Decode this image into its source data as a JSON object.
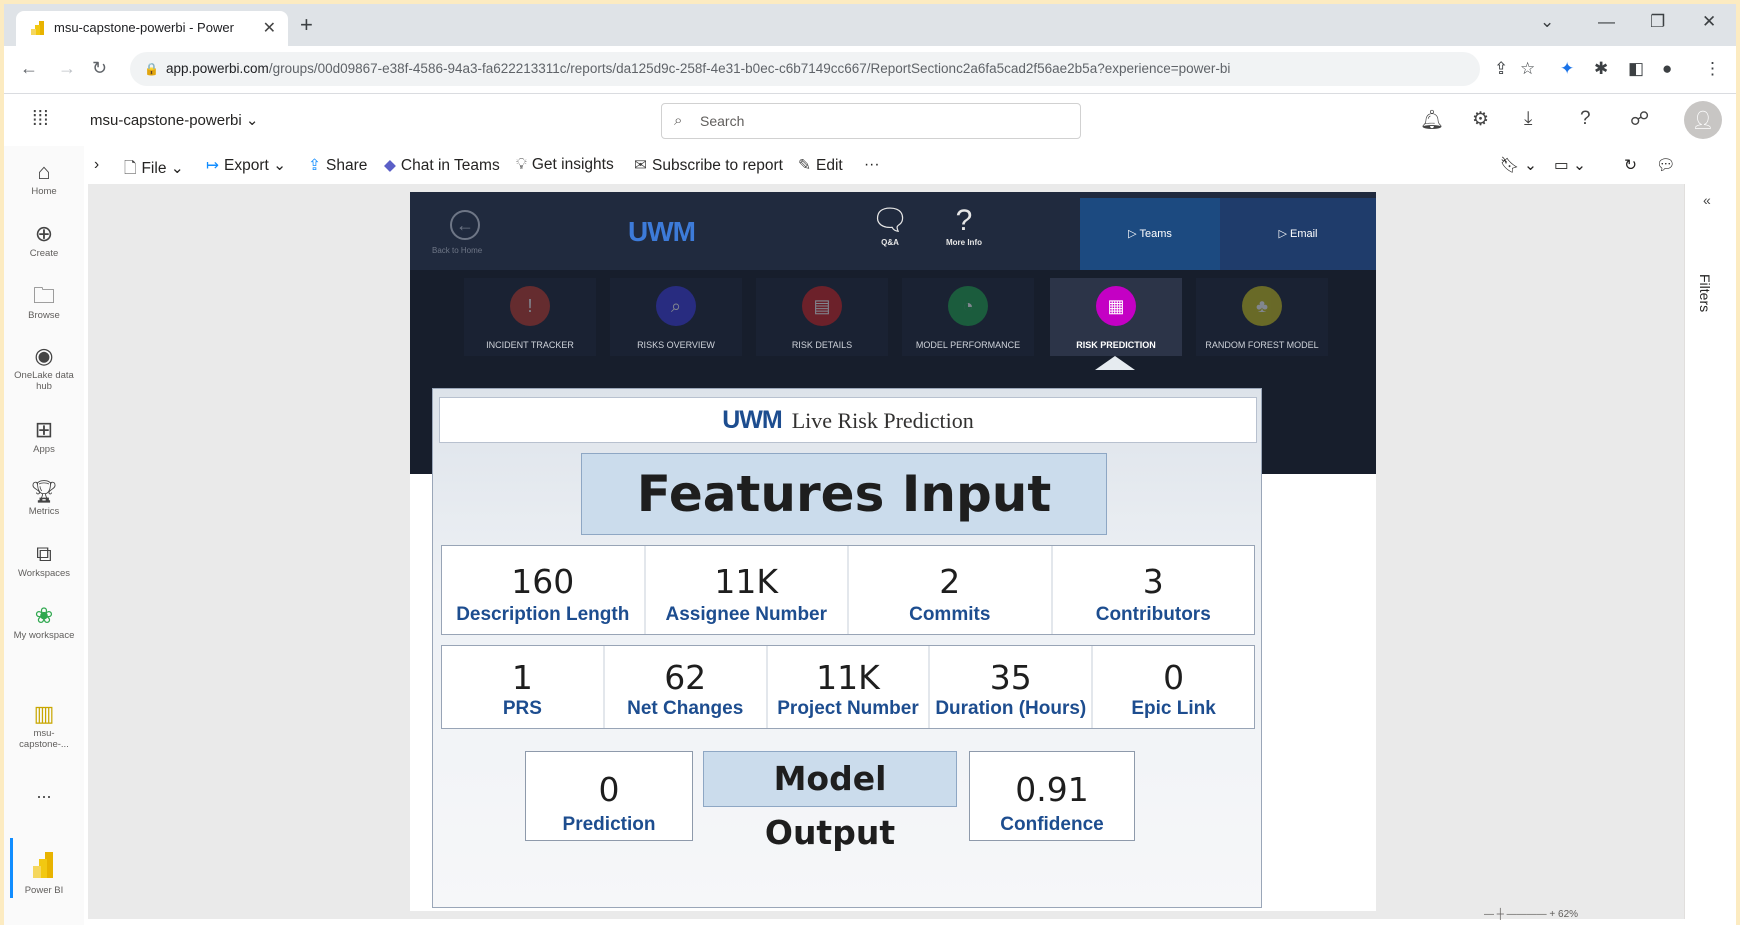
{
  "browser": {
    "tab_title": "msu-capstone-powerbi - Power",
    "url_host": "app.powerbi.com",
    "url_path": "/groups/00d09867-e38f-4586-94a3-fa622213311c/reports/da125d9c-258f-4e31-b0ec-c6b7149cc667/ReportSectionc2a6fa5cad2f56ae2b5a?experience=power-bi"
  },
  "header": {
    "workspace": "msu-capstone-powerbi",
    "search_placeholder": "Search"
  },
  "rail": {
    "items": [
      {
        "label": "Home",
        "icon": "home-icon"
      },
      {
        "label": "Create",
        "icon": "create-icon"
      },
      {
        "label": "Browse",
        "icon": "folder-icon"
      },
      {
        "label": "OneLake data hub",
        "icon": "onelake-icon"
      },
      {
        "label": "Apps",
        "icon": "apps-icon"
      },
      {
        "label": "Metrics",
        "icon": "trophy-icon"
      },
      {
        "label": "Workspaces",
        "icon": "workspaces-icon"
      },
      {
        "label": "My workspace",
        "icon": "my-workspace-icon"
      },
      {
        "label": "msu-capstone-...",
        "icon": "report-icon"
      }
    ],
    "more": "...",
    "product": "Power BI"
  },
  "toolbar": {
    "file": "File",
    "export": "Export",
    "share": "Share",
    "chat": "Chat in Teams",
    "insights": "Get insights",
    "subscribe": "Subscribe to report",
    "edit": "Edit",
    "more": "···"
  },
  "report": {
    "back_label": "Back to Home",
    "logo": "UWM",
    "qa_label": "Q&A",
    "moreinfo_label": "More Info",
    "teams_label": "Teams",
    "email_label": "Email",
    "pages": [
      {
        "label": "INCIDENT TRACKER",
        "color": "#c0392b"
      },
      {
        "label": "RISKS OVERVIEW",
        "color": "#3a3adf"
      },
      {
        "label": "RISK DETAILS",
        "color": "#d12020"
      },
      {
        "label": "MODEL PERFORMANCE",
        "color": "#1ea34a"
      },
      {
        "label": "RISK PREDICTION",
        "color": "#c400c4"
      },
      {
        "label": "RANDOM FOREST MODEL",
        "color": "#c9c21a"
      }
    ],
    "title_logo": "UWM",
    "title": "Live Risk Prediction",
    "features_title": "Features Input",
    "row1": [
      {
        "value": "160",
        "label": "Description Length"
      },
      {
        "value": "11K",
        "label": "Assignee Number"
      },
      {
        "value": "2",
        "label": "Commits"
      },
      {
        "value": "3",
        "label": "Contributors"
      }
    ],
    "row2": [
      {
        "value": "1",
        "label": "PRS"
      },
      {
        "value": "62",
        "label": "Net Changes"
      },
      {
        "value": "11K",
        "label": "Project Number"
      },
      {
        "value": "35",
        "label": "Duration (Hours)"
      },
      {
        "value": "0",
        "label": "Epic Link"
      }
    ],
    "model_output_title": "Model Output",
    "prediction": {
      "value": "0",
      "label": "Prediction"
    },
    "confidence": {
      "value": "0.91",
      "label": "Confidence"
    }
  },
  "filters_label": "Filters",
  "zoom": "62%"
}
